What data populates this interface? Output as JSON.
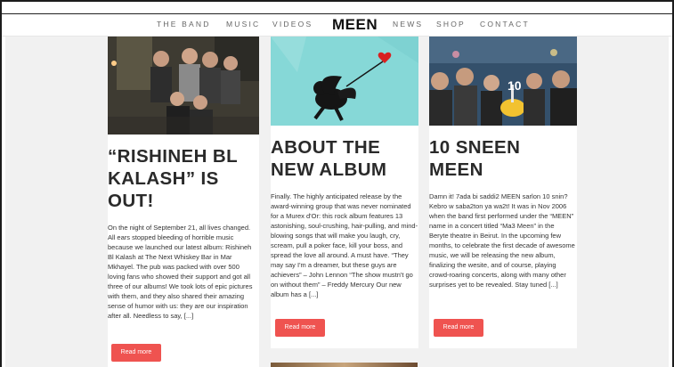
{
  "nav": {
    "items": [
      {
        "key": "the_band",
        "label": "THE BAND"
      },
      {
        "key": "music",
        "label": "MUSIC"
      },
      {
        "key": "videos",
        "label": "VIDEOS"
      },
      {
        "key": "news",
        "label": "NEWS"
      },
      {
        "key": "shop",
        "label": "SHOP"
      },
      {
        "key": "contact",
        "label": "CONTACT"
      }
    ],
    "logo": "MEEN"
  },
  "posts": [
    {
      "title": "“RISHINEH BL KALASH” IS OUT!",
      "excerpt": "On the night of September 21, all lives changed. All ears stopped bleeding of horrible music because we launched our latest album: Rishineh Bl Kalash at The Next Whiskey Bar in Mar Mkhayel. The pub was packed with over 500 loving fans who showed their support and got all three of our albums! We took lots of epic pictures with them, and they also shared their amazing sense of humor with us: they are our inspiration after all. Needless to say, [...]",
      "button": "Read more"
    },
    {
      "title": "ABOUT THE NEW ALBUM",
      "excerpt": "Finally. The highly anticipated release by the award-winning group that was never nominated for a Murex d'Or: this rock album features 13 astonishing, soul-crushing, hair-pulling, and mind-blowing songs that will make you laugh, cry, scream, pull a poker face, kill your boss, and spread the love all around. A must have. “They may say I'm a dreamer, but these guys are achievers” – John Lennon “The show mustn't go on without them” – Freddy Mercury Our new album has a [...]",
      "button": "Read more"
    },
    {
      "title": "10 SNEEN MEEN",
      "excerpt": "Damn it! 7ada bi saddi2 MEEN sarlon 10 snin? Kebro w saba2ton ya wa2t! It was in Nov 2006 when the band first performed under the “MEEN” name in a concert titled “Ma3 Meen” in the Beryte theatre in Beirut. In the upcoming few months, to celebrate the first decade of awesome music, we will be releasing the new album, finalizing the wesite, and of course, playing crowd-roaring concerts, along with many other surprises yet to be revealed. Stay tuned [...]",
      "button": "Read more"
    }
  ],
  "colors": {
    "accent": "#ef5350",
    "title": "#2a2a2a",
    "page_bg": "#f1f1f1",
    "card_bg": "#ffffff"
  }
}
